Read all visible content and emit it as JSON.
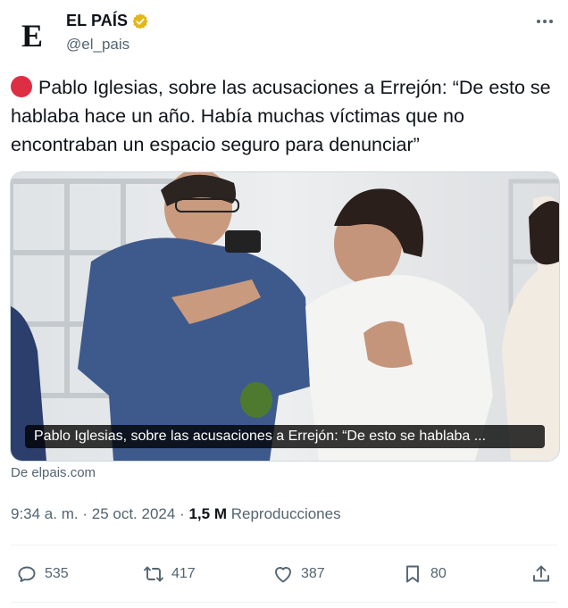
{
  "author": {
    "display_name": "EL PAÍS",
    "handle": "@el_pais",
    "avatar_letter": "E",
    "verified": true
  },
  "tweet": {
    "text": "Pablo Iglesias, sobre las acusaciones a Errejón: “De esto se hablaba hace un año. Había muchas víctimas que no encontraban un espacio seguro para denunciar”",
    "leading_emoji": "red-circle"
  },
  "media": {
    "caption": "Pablo Iglesias, sobre las acusaciones a Errejón: “De esto se hablaba ..."
  },
  "source": {
    "label": "De elpais.com"
  },
  "meta": {
    "time": "9:34 a. m.",
    "separator": "·",
    "date": "25 oct. 2024",
    "views_count": "1,5 M",
    "views_label": "Reproducciones"
  },
  "actions": {
    "replies": "535",
    "reposts": "417",
    "likes": "387",
    "bookmarks": "80"
  },
  "colors": {
    "text": "#0f1419",
    "secondary": "#536471",
    "verified_gold": "#e2b719",
    "emoji_red": "#dd2e44"
  }
}
